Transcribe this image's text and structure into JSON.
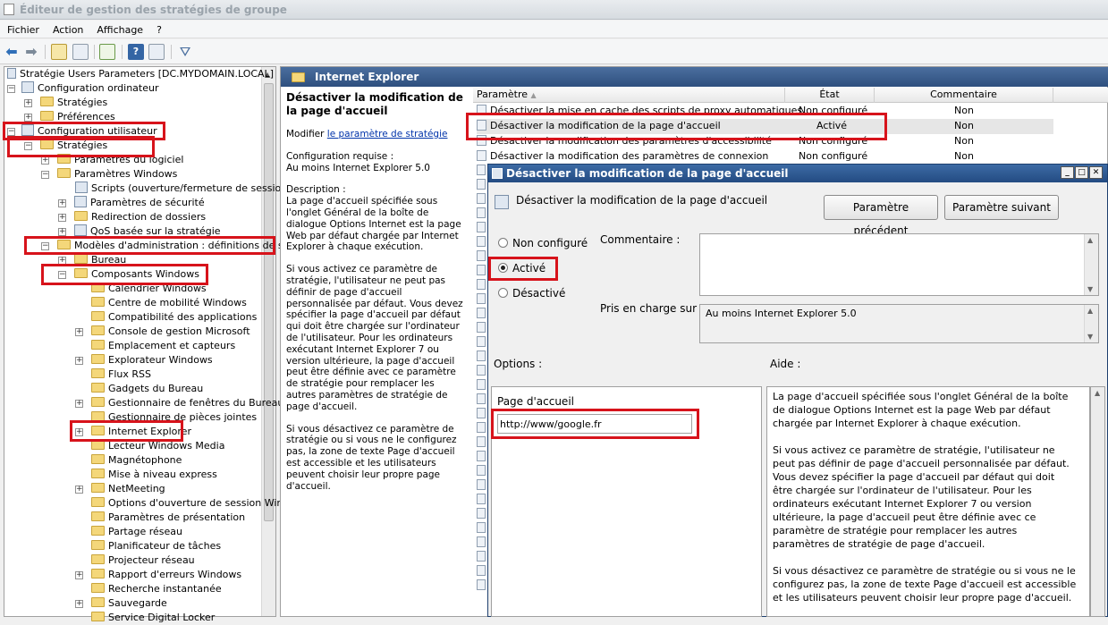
{
  "window": {
    "title": "Éditeur de gestion des stratégies de groupe"
  },
  "menu": [
    "Fichier",
    "Action",
    "Affichage",
    "?"
  ],
  "tree": {
    "root": "Stratégie Users Parameters [DC.MYDOMAIN.LOCAL]",
    "items": [
      "Configuration ordinateur",
      "Stratégies",
      "Préférences",
      "Configuration utilisateur",
      "Stratégies",
      "Paramètres du logiciel",
      "Paramètres Windows",
      "Scripts (ouverture/fermeture de session",
      "Paramètres de sécurité",
      "Redirection de dossiers",
      "QoS basée sur la stratégie",
      "Modèles d'administration : définitions de stra",
      "Bureau",
      "Composants Windows",
      "Calendrier Windows",
      "Centre de mobilité Windows",
      "Compatibilité des applications",
      "Console de gestion Microsoft",
      "Emplacement et capteurs",
      "Explorateur Windows",
      "Flux RSS",
      "Gadgets du Bureau",
      "Gestionnaire de fenêtres du Bureau",
      "Gestionnaire de pièces jointes",
      "Internet Explorer",
      "Lecteur Windows Media",
      "Magnétophone",
      "Mise à niveau express",
      "NetMeeting",
      "Options d'ouverture de session Wind",
      "Paramètres de présentation",
      "Partage réseau",
      "Planificateur de tâches",
      "Projecteur réseau",
      "Rapport d'erreurs Windows",
      "Recherche instantanée",
      "Sauvegarde",
      "Service Digital Locker"
    ]
  },
  "pane": {
    "header": "Internet Explorer",
    "desc_title": "Désactiver la modification de la page d'accueil",
    "modify_prefix": "Modifier ",
    "modify_link": "le paramètre de stratégie",
    "req_label": "Configuration requise :",
    "req_value": "Au moins Internet Explorer 5.0",
    "desc_label": "Description :",
    "desc_p1": "La page d'accueil spécifiée sous l'onglet Général de la boîte de dialogue Options Internet est la page Web par défaut chargée par Internet Explorer à chaque exécution.",
    "desc_p2": "Si vous activez ce paramètre de stratégie, l'utilisateur ne peut pas définir de page d'accueil personnalisée par défaut. Vous devez spécifier la page d'accueil par défaut qui doit être chargée sur l'ordinateur de l'utilisateur. Pour les ordinateurs exécutant Internet Explorer 7 ou version ultérieure, la page d'accueil peut être définie avec ce paramètre de stratégie pour remplacer les autres paramètres de stratégie de page d'accueil.",
    "desc_p3": "Si vous désactivez ce paramètre de stratégie ou si vous ne le configurez pas, la zone de texte Page d'accueil est accessible et les utilisateurs peuvent choisir leur propre page d'accueil."
  },
  "list": {
    "headers": [
      "Paramètre",
      "État",
      "Commentaire"
    ],
    "rows": [
      {
        "name": "Désactiver la mise en cache des scripts de proxy automatiques",
        "state": "Non configuré",
        "comment": "Non"
      },
      {
        "name": "Désactiver la modification de la page d'accueil",
        "state": "Activé",
        "comment": "Non"
      },
      {
        "name": "Désactiver la modification des paramètres d'accessibilité",
        "state": "Non configuré",
        "comment": "Non"
      },
      {
        "name": "Désactiver la modification des paramètres de connexion",
        "state": "Non configuré",
        "comment": "Non"
      }
    ]
  },
  "dialog": {
    "title": "Désactiver la modification de la page d'accueil",
    "heading": "Désactiver la modification de la page d'accueil",
    "prev_button": "Paramètre précédent",
    "next_button": "Paramètre suivant",
    "radio_not_configured": "Non configuré",
    "radio_enabled": "Activé",
    "radio_disabled": "Désactivé",
    "selected_option": "Activé",
    "comment_label": "Commentaire :",
    "supported_label": "Pris en charge sur :",
    "supported_value": "Au moins Internet Explorer 5.0",
    "options_label": "Options :",
    "help_label": "Aide :",
    "homepage_label": "Page d'accueil",
    "homepage_value": "http://www/google.fr",
    "help_p1": "La page d'accueil spécifiée sous l'onglet Général de la boîte de dialogue Options Internet est la page Web par défaut chargée par Internet Explorer à chaque exécution.",
    "help_p2": "Si vous activez ce paramètre de stratégie, l'utilisateur ne peut pas définir de page d'accueil personnalisée par défaut. Vous devez spécifier la page d'accueil par défaut qui doit être chargée sur l'ordinateur de l'utilisateur. Pour les ordinateurs exécutant Internet Explorer 7 ou version ultérieure, la page d'accueil peut être définie avec ce paramètre de stratégie pour remplacer les autres paramètres de stratégie de page d'accueil.",
    "help_p3": "Si vous désactivez ce paramètre de stratégie ou si vous ne le configurez pas, la zone de texte Page d'accueil est accessible et les utilisateurs peuvent choisir leur propre page d'accueil."
  },
  "colors": {
    "highlight": "#d7131b",
    "header": "#2e4f7e"
  }
}
